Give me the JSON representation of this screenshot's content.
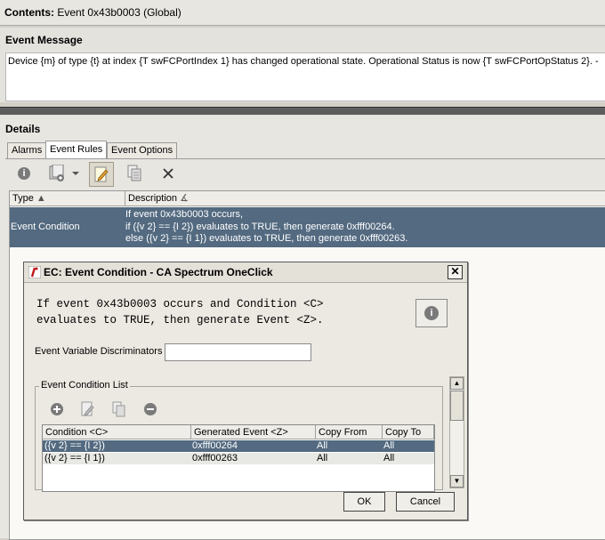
{
  "contents_bar": {
    "label": "Contents:",
    "value": "Event 0x43b0003  (Global)"
  },
  "event_message": {
    "heading": "Event Message",
    "text": "Device {m} of type {t} at index {T swFCPortIndex 1} has changed operational state. Operational Status is now {T swFCPortOpStatus 2}. -"
  },
  "details": {
    "heading": "Details",
    "tabs": [
      {
        "label": "Alarms"
      },
      {
        "label": "Event Rules"
      },
      {
        "label": "Event Options"
      }
    ],
    "toolbar": [
      "info-icon",
      "add-rule-icon",
      "edit-icon",
      "copy-icon",
      "delete-icon"
    ],
    "table": {
      "columns": [
        "Type",
        "Description"
      ],
      "rows": [
        {
          "type": "Event Condition",
          "description": [
            "If event 0x43b0003 occurs,",
            "if ({v 2} == {I 2}) evaluates to TRUE, then generate 0xfff00264.",
            "else ({v 2} == {I 1}) evaluates to TRUE, then generate 0xfff00263."
          ]
        }
      ]
    }
  },
  "dialog": {
    "title": "EC: Event Condition - CA Spectrum OneClick",
    "description_line1": "If event 0x43b0003 occurs and Condition <C>",
    "description_line2": "evaluates to TRUE, then generate Event <Z>.",
    "discriminators_label": "Event Variable Discriminators",
    "discriminators_value": "",
    "list_legend": "Event Condition List",
    "list_columns": [
      "Condition <C>",
      "Generated Event <Z>",
      "Copy From",
      "Copy To"
    ],
    "list_rows": [
      {
        "condition": "({v 2} == {I 2})",
        "event": "0xfff00264",
        "copy_from": "All",
        "copy_to": "All"
      },
      {
        "condition": "({v 2} == {I 1})",
        "event": "0xfff00263",
        "copy_from": "All",
        "copy_to": "All"
      }
    ],
    "ok_label": "OK",
    "cancel_label": "Cancel"
  },
  "colors": {
    "selection": "#536a80",
    "divider": "#5e5e5e"
  }
}
